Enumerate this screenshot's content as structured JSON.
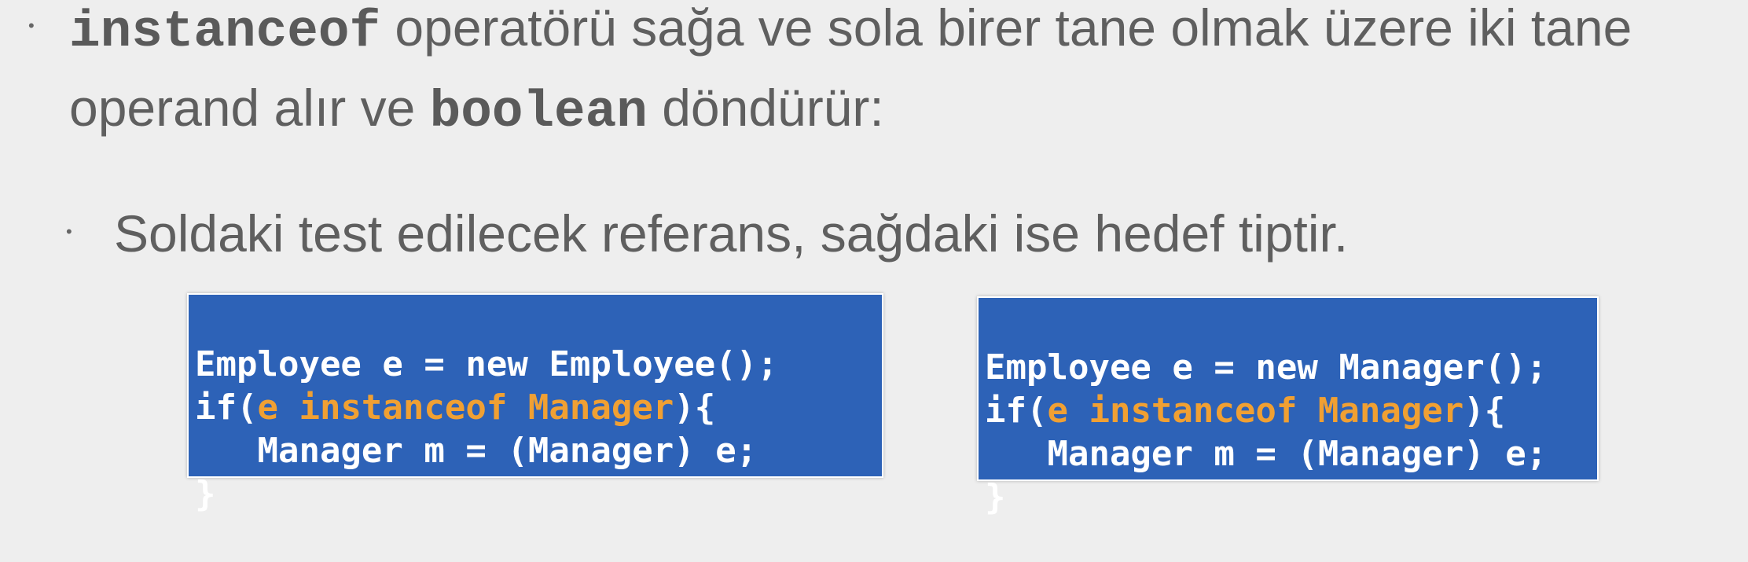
{
  "bullet1": {
    "keyword": "instanceof",
    "text_a": " operatörü sağa ve sola birer tane olmak üzere iki tane",
    "text_b": "operand alır ve ",
    "keyword2": "boolean",
    "text_c": " döndürür:"
  },
  "bullet2": {
    "text": "Soldaki test edilecek referans, sağdaki ise hedef tiptir."
  },
  "code_left": {
    "line1": "Employee e = new Employee();",
    "line2_pre": "if(",
    "line2_hi": "e instanceof Manager",
    "line2_post": "){",
    "line3": "   Manager m = (Manager) e;",
    "line4": "}"
  },
  "code_right": {
    "line1": "Employee e = new Manager();",
    "line2_pre": "if(",
    "line2_hi": "e instanceof Manager",
    "line2_post": "){",
    "line3": "   Manager m = (Manager) e;",
    "line4": "}"
  },
  "colors": {
    "background": "#eeeeee",
    "text": "#5f5f5f",
    "code_bg": "#2d62b7",
    "code_text": "#ffffff",
    "code_highlight": "#f0a033"
  }
}
